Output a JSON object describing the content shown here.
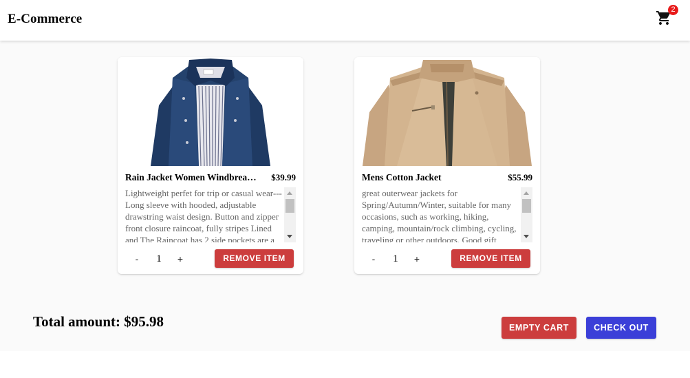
{
  "header": {
    "brand": "E-Commerce",
    "cart_icon": "shopping-cart-icon",
    "cart_count": "2",
    "badge_color": "#e81a1a"
  },
  "cart": {
    "items": [
      {
        "title": "Rain Jacket Women Windbreaker Striped Climbing Raincoats",
        "price": "$39.99",
        "description": "Lightweight perfet for trip or casual wear---Long sleeve with hooded, adjustable drawstring waist design. Button and zipper front closure raincoat, fully stripes Lined and The Raincoat has 2 side pockets are a good size to hold all kinds of things, it covers the hips, and the hood is generous but doesn't overdo it.",
        "quantity": "1",
        "minus_label": "-",
        "plus_label": "+",
        "remove_label": "REMOVE ITEM",
        "image": "navy-rain-jacket-image"
      },
      {
        "title": "Mens Cotton Jacket",
        "price": "$55.99",
        "description": "great outerwear jackets for Spring/Autumn/Winter, suitable for many occasions, such as working, hiking, camping, mountain/rock climbing, cycling, traveling or other outdoors. Good gift choice for you or your family member.",
        "quantity": "1",
        "minus_label": "-",
        "plus_label": "+",
        "remove_label": "REMOVE ITEM",
        "image": "khaki-cotton-jacket-image"
      }
    ],
    "total_label": "Total amount: $95.98",
    "empty_label": "EMPTY CART",
    "checkout_label": "CHECK OUT"
  },
  "colors": {
    "danger": "#cc3d3d",
    "primary": "#3b3fd8",
    "background": "#fafafa"
  }
}
